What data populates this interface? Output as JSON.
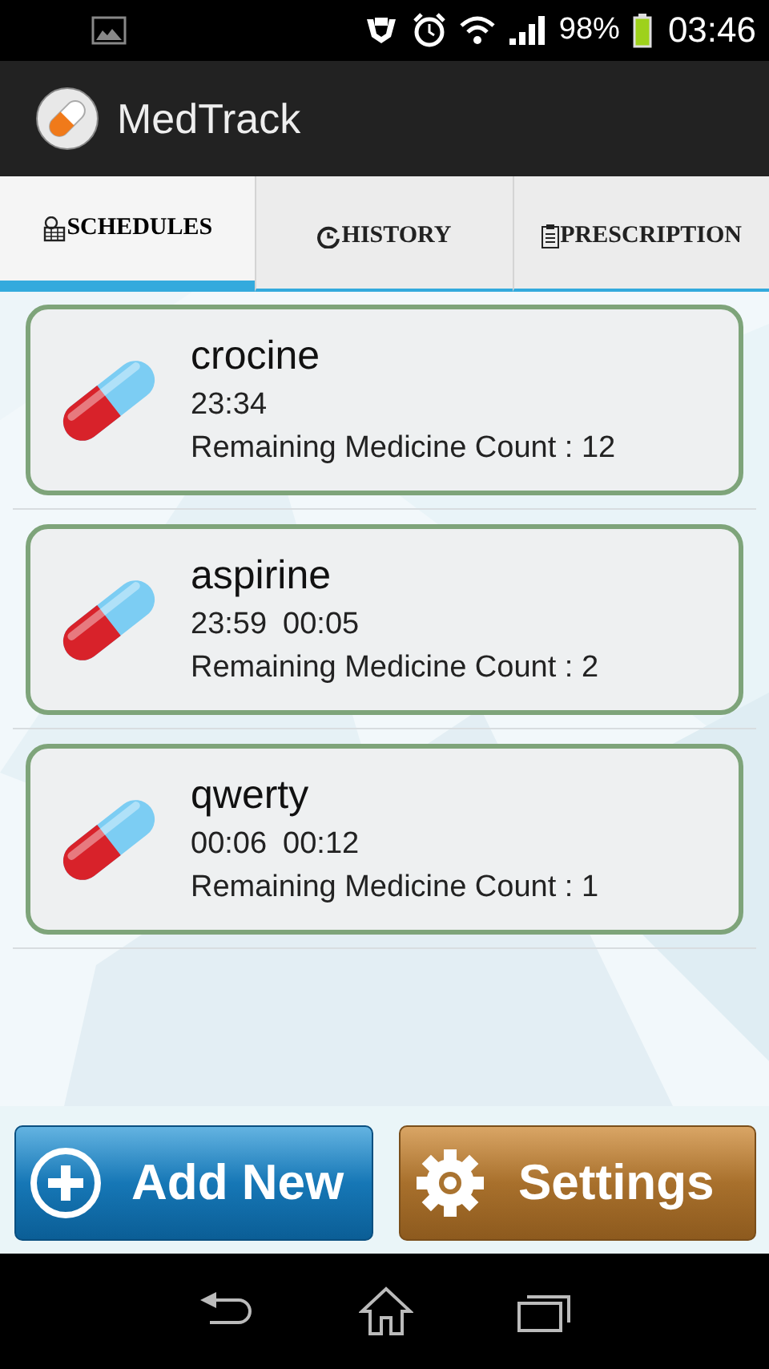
{
  "status_bar": {
    "battery": "98%",
    "time": "03:46"
  },
  "app_bar": {
    "title": "MedTrack"
  },
  "tabs": [
    {
      "label": "SCHEDULES",
      "kind": "schedules",
      "selected": true
    },
    {
      "label": "HISTORY",
      "kind": "history",
      "selected": false
    },
    {
      "label": "PRESCRIPTION",
      "kind": "prescription",
      "selected": false
    }
  ],
  "medicines": [
    {
      "name": "crocine",
      "times": [
        "23:34"
      ],
      "remaining": "Remaining Medicine Count : 12"
    },
    {
      "name": "aspirine",
      "times": [
        "23:59",
        "00:05"
      ],
      "remaining": "Remaining Medicine Count : 2"
    },
    {
      "name": "qwerty",
      "times": [
        "00:06",
        "00:12"
      ],
      "remaining": "Remaining Medicine Count : 1"
    }
  ],
  "buttons": [
    {
      "label": "Add New",
      "kind": "add"
    },
    {
      "label": "Settings",
      "kind": "settings"
    }
  ]
}
